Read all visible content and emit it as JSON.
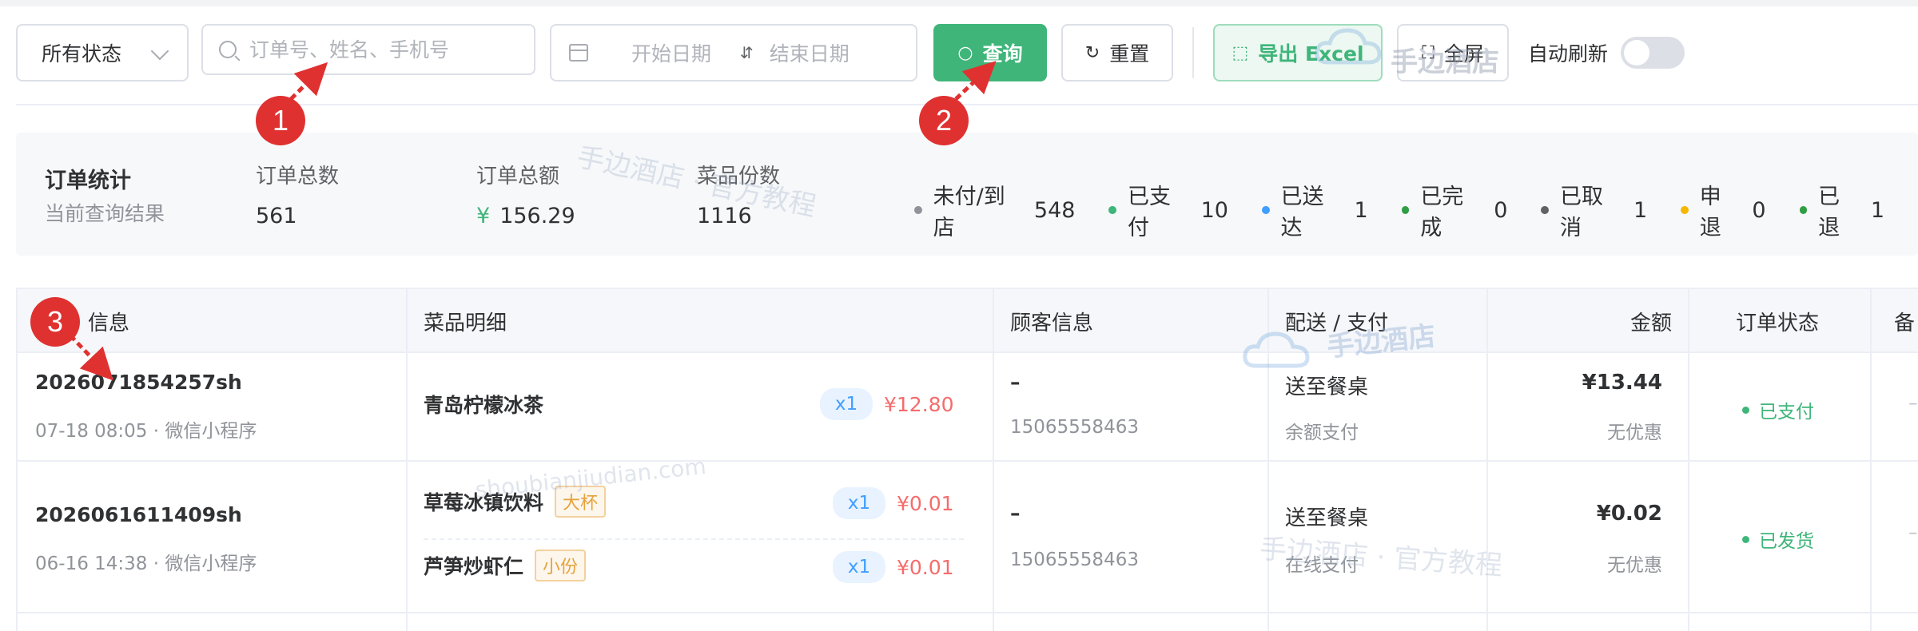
{
  "toolbar": {
    "status_select": "所有状态",
    "search_placeholder": "订单号、姓名、手机号",
    "start_date_placeholder": "开始日期",
    "end_date_placeholder": "结束日期",
    "query_label": "查询",
    "reset_label": "重置",
    "export_label": "导出 Excel",
    "fullscreen_label": "全屏",
    "auto_refresh_label": "自动刷新"
  },
  "stats": {
    "title": "订单统计",
    "subtitle": "当前查询结果",
    "order_count_label": "订单总数",
    "order_count": "561",
    "order_amount_label": "订单总额",
    "currency": "¥",
    "order_amount": "156.29",
    "dish_count_label": "菜品份数",
    "dish_count": "1116",
    "legend": [
      {
        "label": "未付/到店",
        "count": "548",
        "color": "#909399"
      },
      {
        "label": "已支付",
        "count": "10",
        "color": "#3fb57a"
      },
      {
        "label": "已送达",
        "count": "1",
        "color": "#409eff"
      },
      {
        "label": "已完成",
        "count": "0",
        "color": "#2f9e44"
      },
      {
        "label": "已取消",
        "count": "1",
        "color": "#606266"
      },
      {
        "label": "申退",
        "count": "0",
        "color": "#f5b800"
      },
      {
        "label": "已退",
        "count": "1",
        "color": "#2f9e44"
      }
    ]
  },
  "table": {
    "headers": {
      "order": "信息",
      "dishes": "菜品明细",
      "customer": "顾客信息",
      "delivery": "配送 / 支付",
      "amount": "金额",
      "status": "订单状态",
      "remark": "备"
    },
    "rows": [
      {
        "order_no": "2026071854257sh",
        "meta": "07-18 08:05 · 微信小程序",
        "dishes": [
          {
            "name": "青岛柠檬冰茶",
            "spec": "",
            "qty": "x1",
            "price": "¥12.80"
          }
        ],
        "customer_name": "–",
        "phone": "15065558463",
        "delivery": "送至餐桌",
        "payment": "余额支付",
        "amount": "¥13.44",
        "discount": "无优惠",
        "status": "已支付",
        "remark": "–"
      },
      {
        "order_no": "2026061611409sh",
        "meta": "06-16 14:38 · 微信小程序",
        "dishes": [
          {
            "name": "草莓冰镇饮料",
            "spec": "大杯",
            "qty": "x1",
            "price": "¥0.01"
          },
          {
            "name": "芦笋炒虾仁",
            "spec": "小份",
            "qty": "x1",
            "price": "¥0.01"
          }
        ],
        "customer_name": "–",
        "phone": "15065558463",
        "delivery": "送至餐桌",
        "payment": "在线支付",
        "amount": "¥0.02",
        "discount": "无优惠",
        "status": "已发货",
        "remark": "–"
      }
    ]
  },
  "watermarks": {
    "brand": "手边酒店",
    "brand_tutorial_1": "手边酒店 · 官方教程",
    "domain": "shoubianjiudian.com",
    "brand_tutorial_2": "手边酒店 · 官方教程"
  },
  "annotations": [
    "1",
    "2",
    "3"
  ]
}
